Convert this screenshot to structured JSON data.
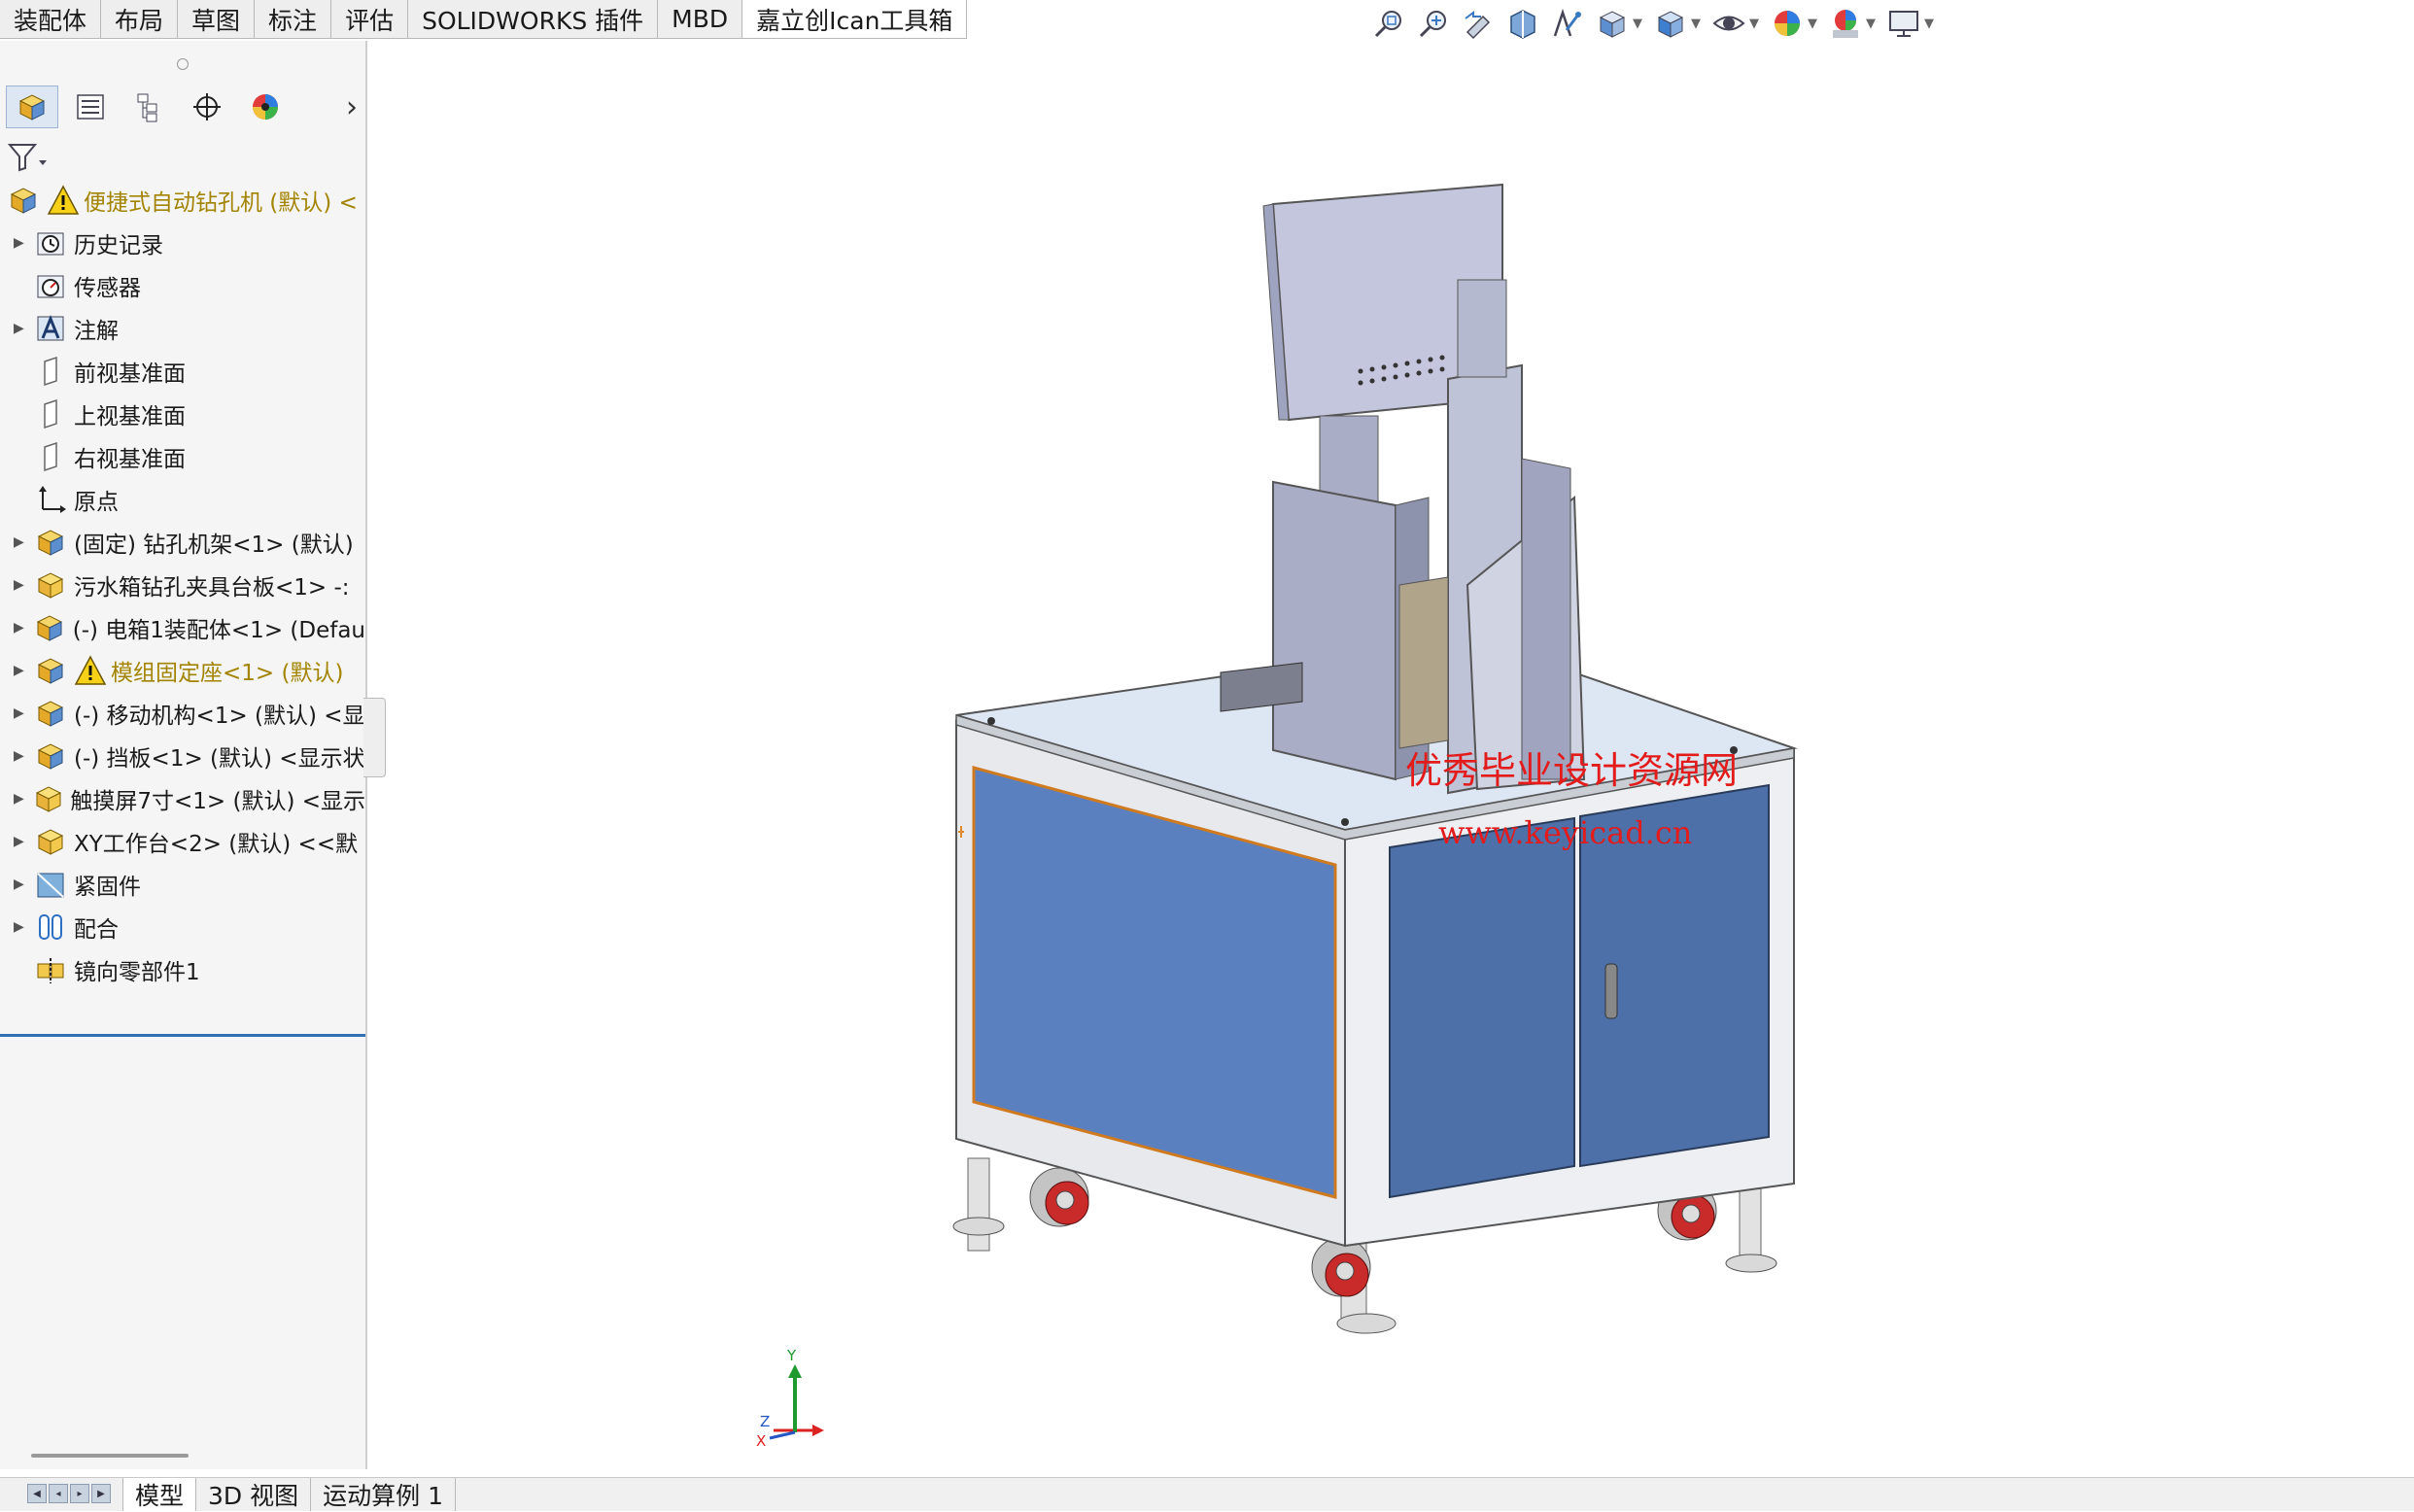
{
  "command_tabs": [
    {
      "label": "装配体"
    },
    {
      "label": "布局"
    },
    {
      "label": "草图"
    },
    {
      "label": "标注"
    },
    {
      "label": "评估"
    },
    {
      "label": "SOLIDWORKS 插件"
    },
    {
      "label": "MBD"
    },
    {
      "label": "嘉立创Ican工具箱"
    }
  ],
  "view_toolbar": [
    "zoom-to-fit-icon",
    "zoom-to-area-icon",
    "previous-view-icon",
    "section-view-icon",
    "dynamic-annotation-icon",
    "view-orientation-icon",
    "display-style-icon",
    "hide-show-items-icon",
    "edit-appearance-icon",
    "apply-scene-icon",
    "view-settings-icon"
  ],
  "feature_tree": {
    "root_label": "便捷式自动钻孔机 (默认) <",
    "items": [
      {
        "label": "历史记录",
        "icon": "history-icon",
        "expandable": true
      },
      {
        "label": "传感器",
        "icon": "sensor-icon",
        "expandable": false
      },
      {
        "label": "注解",
        "icon": "annotation-icon",
        "expandable": true
      },
      {
        "label": "前视基准面",
        "icon": "plane-icon",
        "expandable": false
      },
      {
        "label": "上视基准面",
        "icon": "plane-icon",
        "expandable": false
      },
      {
        "label": "右视基准面",
        "icon": "plane-icon",
        "expandable": false
      },
      {
        "label": "原点",
        "icon": "origin-icon",
        "expandable": false
      },
      {
        "label": "(固定) 钻孔机架<1> (默认)",
        "icon": "assembly-icon",
        "expandable": true
      },
      {
        "label": "污水箱钻孔夹具台板<1> -:",
        "icon": "part-icon",
        "expandable": true
      },
      {
        "label": "(-) 电箱1装配体<1> (Defau",
        "icon": "assembly-icon",
        "expandable": true
      },
      {
        "label": "模组固定座<1> (默认)",
        "icon": "assembly-icon",
        "expandable": true,
        "warning": true
      },
      {
        "label": "(-) 移动机构<1> (默认) <显",
        "icon": "assembly-icon",
        "expandable": true
      },
      {
        "label": "(-) 挡板<1> (默认) <显示状",
        "icon": "assembly-icon",
        "expandable": true
      },
      {
        "label": "触摸屏7寸<1> (默认) <显示",
        "icon": "part-icon",
        "expandable": true
      },
      {
        "label": "XY工作台<2> (默认) <<默",
        "icon": "assembly-icon",
        "expandable": true
      },
      {
        "label": "紧固件",
        "icon": "fastener-folder-icon",
        "expandable": true
      },
      {
        "label": "配合",
        "icon": "mates-icon",
        "expandable": true
      },
      {
        "label": "镜向零部件1",
        "icon": "mirror-component-icon",
        "expandable": false
      }
    ]
  },
  "bottom_tabs": [
    {
      "label": "模型"
    },
    {
      "label": "3D 视图"
    },
    {
      "label": "运动算例 1"
    }
  ],
  "watermark": {
    "line1": "优秀毕业设计资源网",
    "line2": "www.keyicad.cn"
  },
  "triad": {
    "x": "X",
    "y": "Y",
    "z": "Z"
  },
  "colors": {
    "cabinet_panel": "#5a80c0",
    "frame": "#e4e6ea",
    "machine_grey": "#a9adc6",
    "watermark": "#e31b1b",
    "tree_warning_text": "#a38400"
  }
}
